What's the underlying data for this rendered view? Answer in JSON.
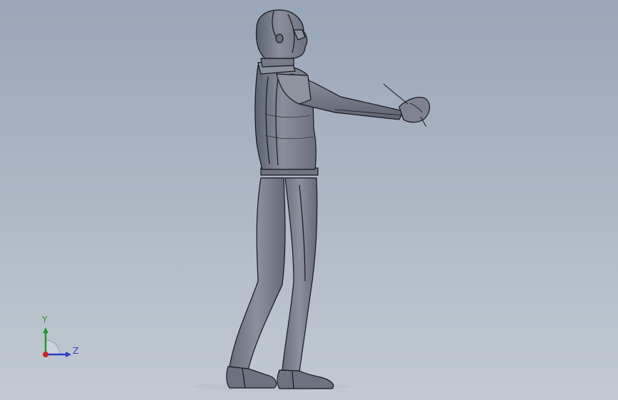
{
  "viewport": {
    "background_top": "#99a6b7",
    "background_bottom": "#c2c9d2",
    "model": {
      "body_color": "#7a7f8c",
      "edge_color": "#15171c"
    }
  },
  "triad": {
    "y_label": "Y",
    "z_label": "Z",
    "y_color": "#1e9a2a",
    "z_color": "#2a3fc8",
    "x_color": "#c8242a"
  }
}
